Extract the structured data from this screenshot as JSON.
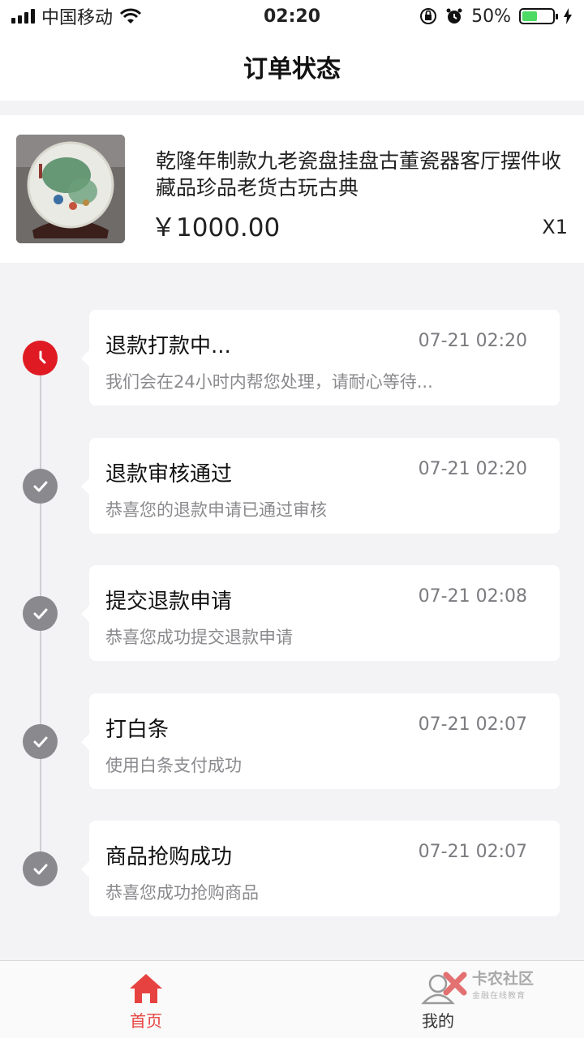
{
  "status_bar": {
    "carrier": "中国移动",
    "time": "02:20",
    "battery_percent": "50%",
    "battery_level": 0.5
  },
  "header": {
    "title": "订单状态"
  },
  "product": {
    "title": "乾隆年制款九老瓷盘挂盘古董瓷器客厅摆件收藏品珍品老货古玩古典",
    "price": "￥1000.00",
    "quantity": "X1"
  },
  "timeline": [
    {
      "title": "退款打款中...",
      "time": "07-21 02:20",
      "desc": "我们会在24小时内帮您处理，请耐心等待...",
      "state": "current",
      "icon": "clock-icon"
    },
    {
      "title": "退款审核通过",
      "time": "07-21 02:20",
      "desc": "恭喜您的退款申请已通过审核",
      "state": "done",
      "icon": "check-icon"
    },
    {
      "title": "提交退款申请",
      "time": "07-21 02:08",
      "desc": "恭喜您成功提交退款申请",
      "state": "done",
      "icon": "check-icon"
    },
    {
      "title": "打白条",
      "time": "07-21 02:07",
      "desc": "使用白条支付成功",
      "state": "done",
      "icon": "check-icon"
    },
    {
      "title": "商品抢购成功",
      "time": "07-21 02:07",
      "desc": "恭喜您成功抢购商品",
      "state": "done",
      "icon": "check-icon"
    }
  ],
  "tab_bar": {
    "tabs": [
      {
        "label": "首页",
        "icon": "home-icon",
        "active": true
      },
      {
        "label": "我的",
        "icon": "user-icon",
        "active": false
      }
    ]
  },
  "watermark": {
    "name": "卡农社区",
    "tagline": "金融在线教育"
  },
  "colors": {
    "accent": "#e64340",
    "current_status": "#e01a22",
    "done_status": "#8a8a8e",
    "background": "#f3f3f5"
  }
}
